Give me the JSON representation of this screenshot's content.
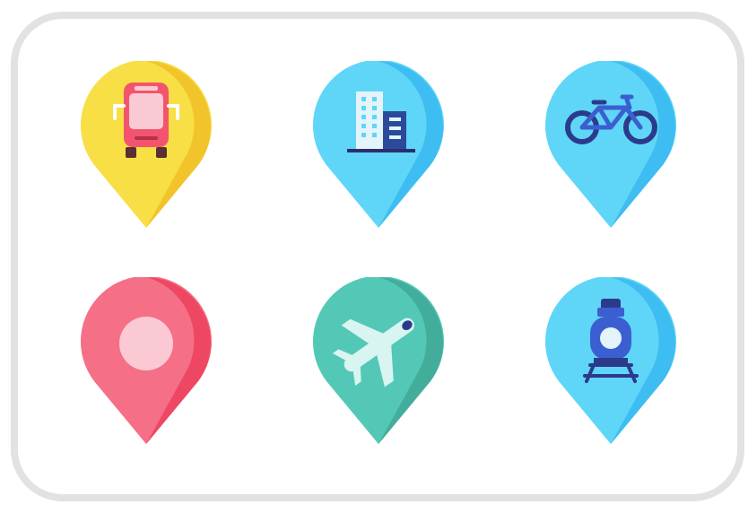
{
  "pins": [
    {
      "id": "bus",
      "icon": "bus-icon",
      "color": "#f7df45",
      "shade": "#f2c42b"
    },
    {
      "id": "building",
      "icon": "building-icon",
      "color": "#5fd6f7",
      "shade": "#3ebdf2"
    },
    {
      "id": "bicycle",
      "icon": "bicycle-icon",
      "color": "#5fd6f7",
      "shade": "#3ebdf2"
    },
    {
      "id": "location",
      "icon": "location-dot-icon",
      "color": "#f56f86",
      "shade": "#ee4763"
    },
    {
      "id": "plane",
      "icon": "airplane-icon",
      "color": "#54c8b6",
      "shade": "#43ad9c"
    },
    {
      "id": "train",
      "icon": "train-icon",
      "color": "#5fd6f7",
      "shade": "#3ebdf2"
    }
  ]
}
